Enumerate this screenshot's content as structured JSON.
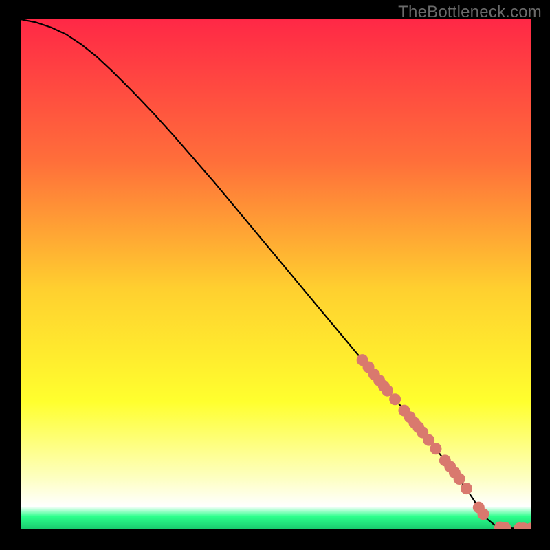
{
  "watermark": "TheBottleneck.com",
  "colors": {
    "background": "#000000",
    "watermark_text": "#6a6a6a",
    "curve": "#000000",
    "dot_fill": "#d9796e",
    "dot_stroke": "#c46458",
    "gradient_top": "#ff2846",
    "gradient_mid1": "#ff6f3a",
    "gradient_mid2": "#ffd02f",
    "gradient_mid3": "#ffff2e",
    "gradient_pale": "#fdffc2",
    "gradient_green": "#2cff8c"
  },
  "chart_data": {
    "type": "line",
    "title": "",
    "xlabel": "",
    "ylabel": "",
    "xlim": [
      0,
      100
    ],
    "ylim": [
      0,
      100
    ],
    "curve": {
      "x": [
        0,
        3,
        6,
        9,
        12,
        15,
        18,
        22,
        26,
        30,
        34,
        38,
        42,
        46,
        50,
        54,
        58,
        62,
        66,
        70,
        74,
        78,
        82,
        86,
        88,
        90,
        91.5,
        93,
        95,
        97,
        99,
        100
      ],
      "y": [
        100,
        99.4,
        98.4,
        97.0,
        95.0,
        92.6,
        89.8,
        85.8,
        81.6,
        77.2,
        72.6,
        68.0,
        63.2,
        58.4,
        53.6,
        48.8,
        44.0,
        39.2,
        34.4,
        29.6,
        24.8,
        20.0,
        15.0,
        9.8,
        7.0,
        4.0,
        2.0,
        0.8,
        0.3,
        0.2,
        0.15,
        0.15
      ]
    },
    "series": [
      {
        "name": "dots",
        "x": [
          67.0,
          68.2,
          69.3,
          70.3,
          71.2,
          71.9,
          73.4,
          75.2,
          76.3,
          77.2,
          78.0,
          78.8,
          80.0,
          81.4,
          83.2,
          84.2,
          85.1,
          86.0,
          87.4,
          89.8,
          90.7,
          94.0,
          95.0,
          97.8,
          98.6,
          100.0
        ],
        "y": [
          33.2,
          31.8,
          30.4,
          29.2,
          28.1,
          27.2,
          25.5,
          23.3,
          22.0,
          20.9,
          20.0,
          19.0,
          17.5,
          15.8,
          13.5,
          12.3,
          11.1,
          9.9,
          8.0,
          4.3,
          3.0,
          0.4,
          0.3,
          0.2,
          0.18,
          0.15
        ]
      }
    ]
  }
}
